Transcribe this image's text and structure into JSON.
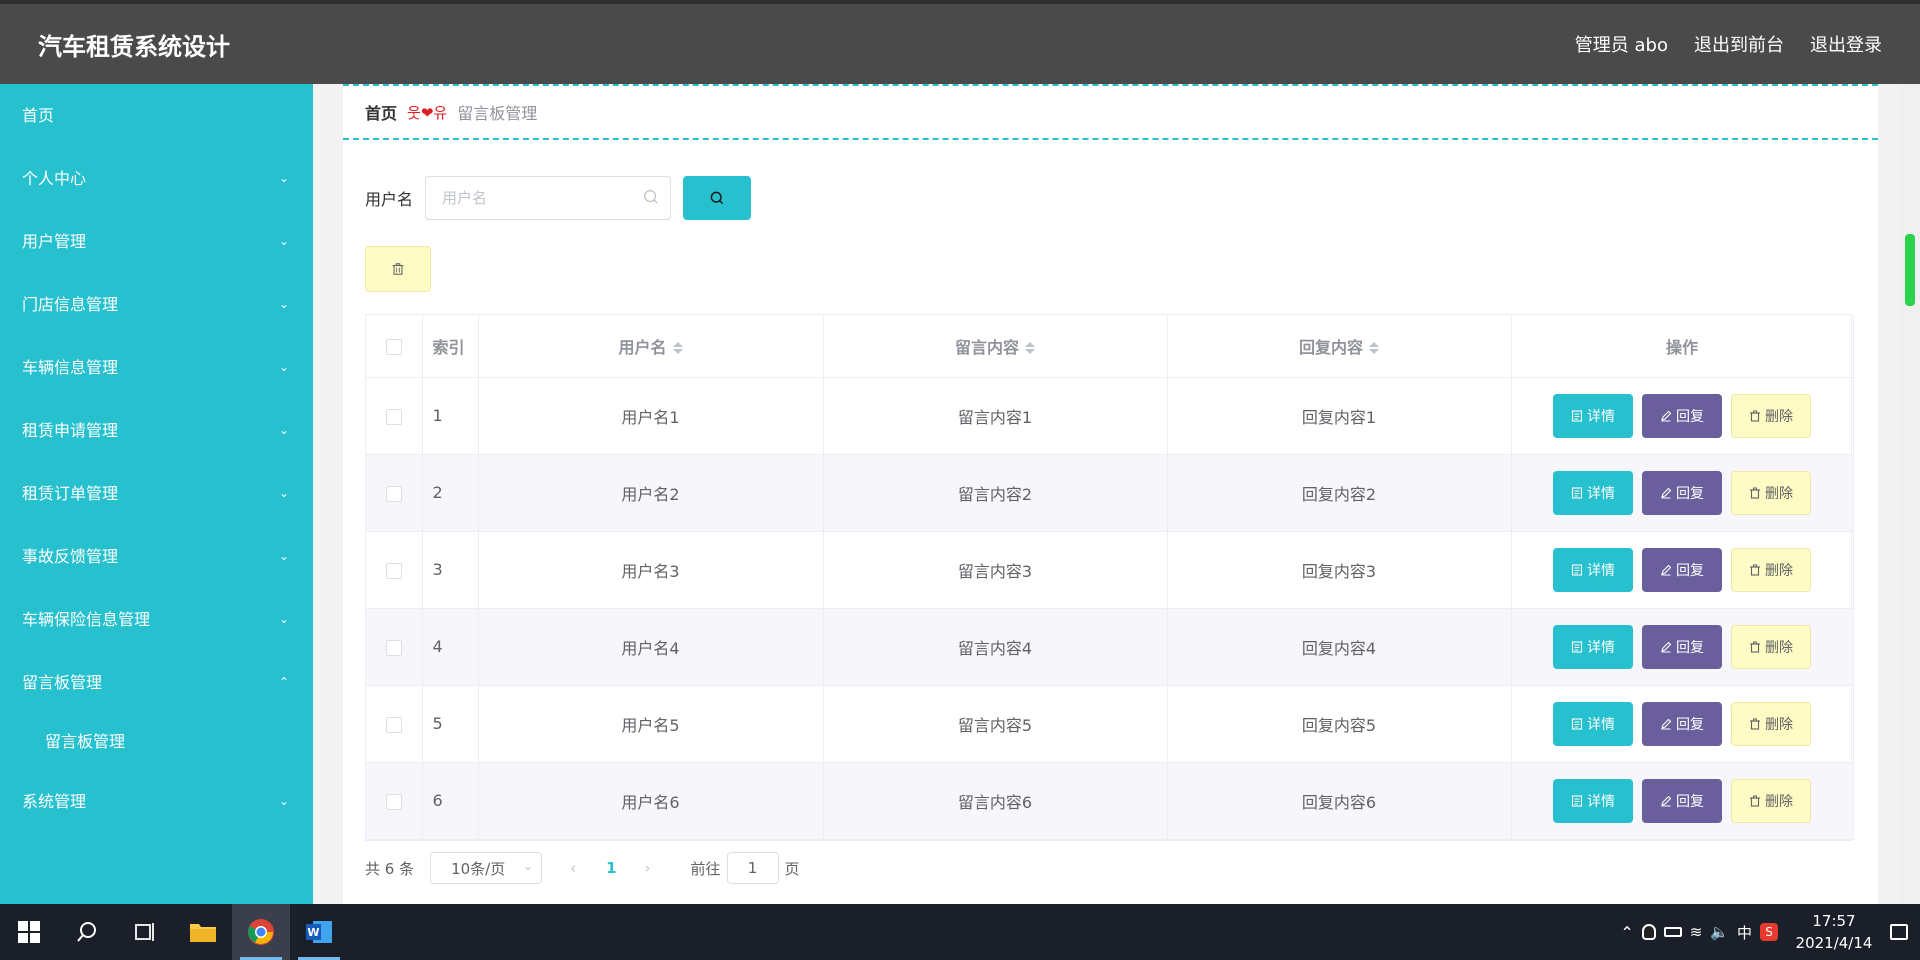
{
  "header": {
    "brand": "汽车租赁系统设计",
    "admin": "管理员 abo",
    "to_front": "退出到前台",
    "logout": "退出登录"
  },
  "sidebar": {
    "items": [
      {
        "label": "首页"
      },
      {
        "label": "个人中心"
      },
      {
        "label": "用户管理"
      },
      {
        "label": "门店信息管理"
      },
      {
        "label": "车辆信息管理"
      },
      {
        "label": "租赁申请管理"
      },
      {
        "label": "租赁订单管理"
      },
      {
        "label": "事故反馈管理"
      },
      {
        "label": "车辆保险信息管理"
      },
      {
        "label": "留言板管理"
      },
      {
        "label": "系统管理"
      }
    ],
    "sub_item": "留言板管理"
  },
  "breadcrumb": {
    "home": "首页",
    "separator": "웃❤유",
    "current": "留言板管理"
  },
  "search": {
    "label": "用户名",
    "placeholder": "用户名"
  },
  "table": {
    "headers": [
      "索引",
      "用户名",
      "留言内容",
      "回复内容",
      "操作"
    ],
    "actions": {
      "detail": "详情",
      "reply": "回复",
      "delete": "删除"
    },
    "rows": [
      {
        "index": "1",
        "user": "用户名1",
        "message": "留言内容1",
        "reply": "回复内容1"
      },
      {
        "index": "2",
        "user": "用户名2",
        "message": "留言内容2",
        "reply": "回复内容2"
      },
      {
        "index": "3",
        "user": "用户名3",
        "message": "留言内容3",
        "reply": "回复内容3"
      },
      {
        "index": "4",
        "user": "用户名4",
        "message": "留言内容4",
        "reply": "回复内容4"
      },
      {
        "index": "5",
        "user": "用户名5",
        "message": "留言内容5",
        "reply": "回复内容5"
      },
      {
        "index": "6",
        "user": "用户名6",
        "message": "留言内容6",
        "reply": "回复内容6"
      }
    ]
  },
  "pagination": {
    "total": "共 6 条",
    "page_size": "10条/页",
    "current_page": "1",
    "goto_prefix": "前往",
    "goto_value": "1",
    "goto_suffix": "页"
  },
  "taskbar": {
    "time": "17:57",
    "date": "2021/4/14",
    "ime": "中"
  },
  "colors": {
    "accent": "#26c0cf",
    "reply_button": "#6a5f9c",
    "delete_button": "#fffbc4",
    "header": "#4a4a4a"
  }
}
